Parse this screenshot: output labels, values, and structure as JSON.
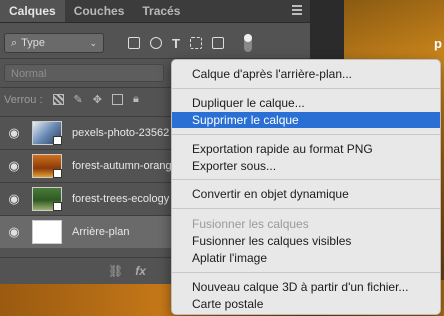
{
  "tabs": [
    "Calques",
    "Couches",
    "Tracés"
  ],
  "filter": {
    "kind_label": "Type"
  },
  "blend_mode": "Normal",
  "lock_label": "Verrou :",
  "layers": [
    {
      "name": "pexels-photo-23562",
      "visible": true
    },
    {
      "name": "forest-autumn-orang",
      "visible": true
    },
    {
      "name": "forest-trees-ecology",
      "visible": true
    },
    {
      "name": "Arrière-plan",
      "visible": true
    }
  ],
  "footer_icons": [
    "link-icon",
    "fx-icon"
  ],
  "photo_text": "p",
  "context_menu": {
    "items": [
      {
        "label": "Calque d'après l'arrière-plan...",
        "state": "normal"
      },
      {
        "label": "Dupliquer le calque...",
        "state": "normal"
      },
      {
        "label": "Supprimer le calque",
        "state": "highlighted"
      },
      {
        "label": "Exportation rapide au format PNG",
        "state": "normal"
      },
      {
        "label": "Exporter sous...",
        "state": "normal"
      },
      {
        "label": "Convertir en objet dynamique",
        "state": "normal"
      },
      {
        "label": "Fusionner les calques",
        "state": "disabled"
      },
      {
        "label": "Fusionner les calques visibles",
        "state": "normal"
      },
      {
        "label": "Aplatir l'image",
        "state": "normal"
      },
      {
        "label": "Nouveau calque 3D à partir d'un fichier...",
        "state": "normal"
      },
      {
        "label": "Carte postale",
        "state": "normal"
      }
    ]
  },
  "colors": {
    "menu_highlight": "#2a6fd4",
    "panel_bg": "#535353"
  }
}
